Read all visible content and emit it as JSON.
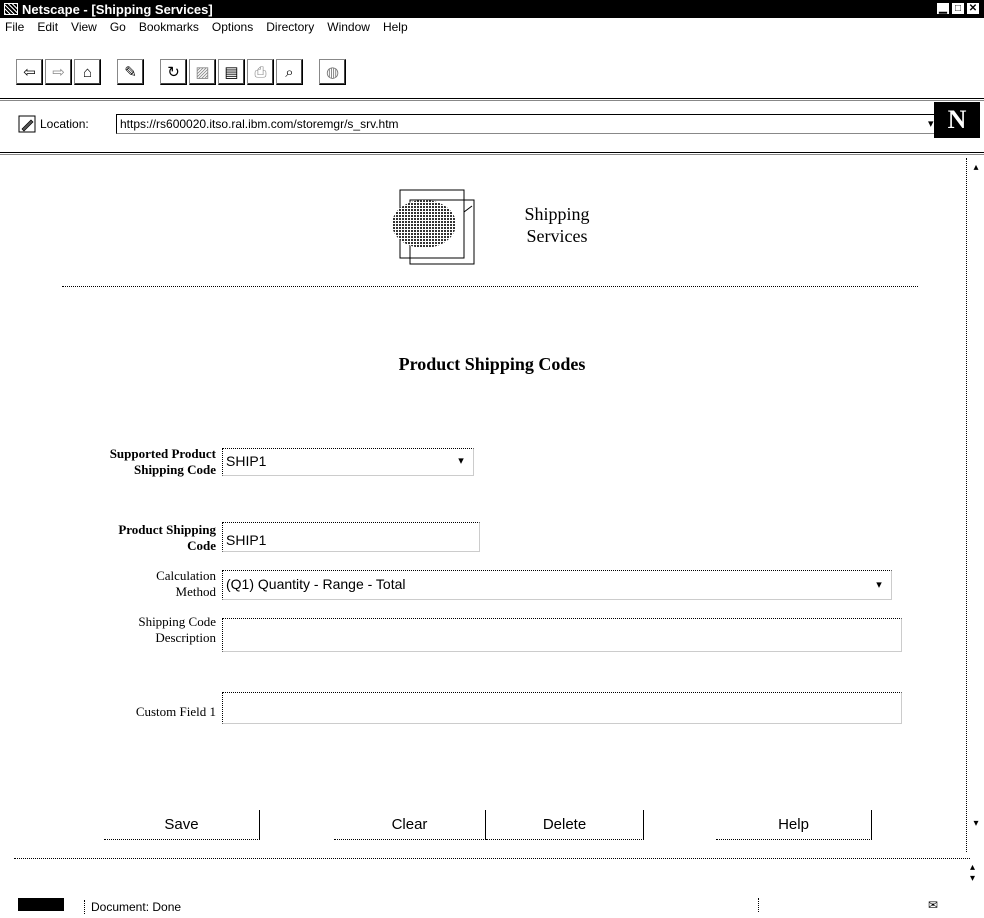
{
  "window": {
    "title": "Netscape - [Shipping Services]",
    "controls": [
      "▁",
      "□",
      "✕"
    ]
  },
  "menu": [
    "File",
    "Edit",
    "View",
    "Go",
    "Bookmarks",
    "Options",
    "Directory",
    "Window",
    "Help"
  ],
  "toolbar": {
    "icons": [
      "back-icon",
      "forward-icon",
      "home-icon",
      "edit-icon",
      "reload-icon",
      "images-icon",
      "open-icon",
      "print-icon",
      "find-icon",
      "stop-icon"
    ]
  },
  "location": {
    "label": "Location:",
    "url": "https://rs600020.itso.ral.ibm.com/storemgr/s_srv.htm"
  },
  "logo_letter": "N",
  "page": {
    "logo_title_line1": "Shipping",
    "logo_title_line2": "Services",
    "section_title": "Product Shipping Codes",
    "supported_label_line1": "Supported Product",
    "supported_label_line2": "Shipping Code",
    "supported_value": "SHIP1",
    "code_label_line1": "Product Shipping",
    "code_label_line2": "Code",
    "code_value": "SHIP1",
    "calc_label_line1": "Calculation",
    "calc_label_line2": "Method",
    "calc_value": "(Q1) Quantity - Range - Total",
    "desc_label_line1": "Shipping Code",
    "desc_label_line2": "Description",
    "desc_value": "",
    "custom_label": "Custom Field 1",
    "custom_value": "",
    "buttons": {
      "save": "Save",
      "clear": "Clear",
      "delete": "Delete",
      "help": "Help"
    }
  },
  "status": {
    "message": "Document: Done"
  }
}
